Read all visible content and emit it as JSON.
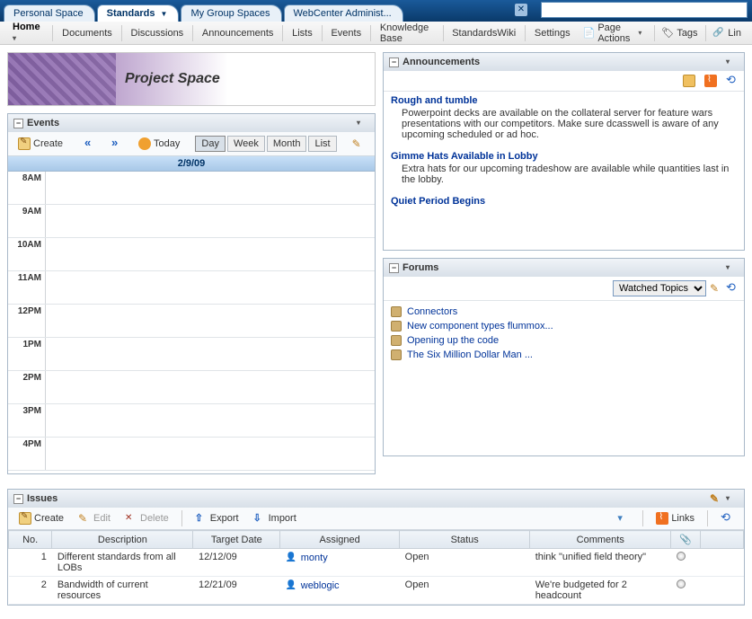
{
  "topnav": {
    "tabs": [
      {
        "label": "Personal Space"
      },
      {
        "label": "Standards",
        "hasMenu": true
      },
      {
        "label": "My Group Spaces"
      },
      {
        "label": "WebCenter Administ..."
      }
    ]
  },
  "secondbar": {
    "home": "Home",
    "items": [
      "Documents",
      "Discussions",
      "Announcements",
      "Lists",
      "Events",
      "Knowledge Base",
      "StandardsWiki",
      "Settings"
    ],
    "page_actions": "Page Actions",
    "tags": "Tags",
    "links": "Lin"
  },
  "banner": {
    "title": "Project Space"
  },
  "events": {
    "title": "Events",
    "create": "Create",
    "today": "Today",
    "views": [
      "Day",
      "Week",
      "Month",
      "List"
    ],
    "active_view": 0,
    "date": "2/9/09",
    "hours": [
      "8AM",
      "9AM",
      "10AM",
      "11AM",
      "12PM",
      "1PM",
      "2PM",
      "3PM",
      "4PM"
    ]
  },
  "announcements": {
    "title": "Announcements",
    "items": [
      {
        "title": "Rough and tumble",
        "body": "Powerpoint decks are available on the collateral server for feature wars presentations with our competitors. Make sure dcasswell is aware of any upcoming scheduled or ad hoc."
      },
      {
        "title": "Gimme Hats Available in Lobby",
        "body": "Extra hats for our upcoming tradeshow are available while quantities last in the lobby."
      },
      {
        "title": "Quiet Period Begins",
        "body": ""
      }
    ]
  },
  "forums": {
    "title": "Forums",
    "filter": "Watched Topics",
    "topics": [
      "Connectors",
      "New component types flummox...",
      "Opening up the code",
      "The Six Million Dollar Man ..."
    ]
  },
  "issues": {
    "title": "Issues",
    "toolbar": {
      "create": "Create",
      "edit": "Edit",
      "delete": "Delete",
      "export": "Export",
      "import": "Import",
      "links": "Links"
    },
    "columns": [
      "No.",
      "Description",
      "Target Date",
      "Assigned",
      "Status",
      "Comments"
    ],
    "attach_col": "📎",
    "rows": [
      {
        "no": "1",
        "desc": "Different standards from all LOBs",
        "date": "12/12/09",
        "assigned": "monty",
        "status": "Open",
        "comments": "think \"unified field theory\""
      },
      {
        "no": "2",
        "desc": "Bandwidth of current resources",
        "date": "12/21/09",
        "assigned": "weblogic",
        "status": "Open",
        "comments": "We're budgeted for 2 headcount"
      }
    ]
  }
}
